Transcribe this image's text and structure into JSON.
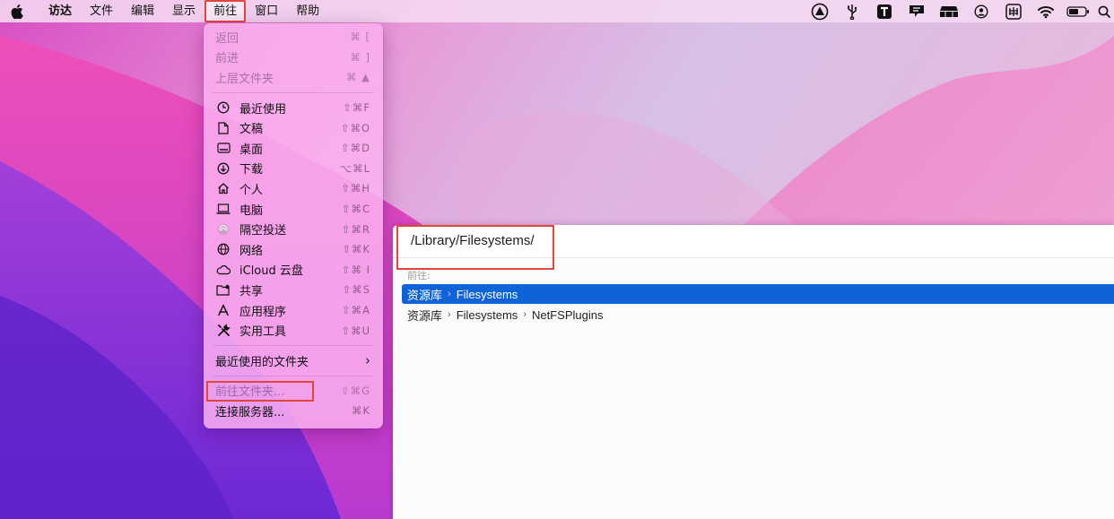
{
  "menubar": {
    "apple_icon": "apple-icon",
    "items": [
      {
        "label": "访达"
      },
      {
        "label": "文件"
      },
      {
        "label": "编辑"
      },
      {
        "label": "显示"
      },
      {
        "label": "前往"
      },
      {
        "label": "窗口"
      },
      {
        "label": "帮助"
      }
    ],
    "status_icons": [
      "triangle-app-icon",
      "usb-icon",
      "text-t-icon",
      "notification-icon",
      "menu-stack-icon",
      "user-circle-icon",
      "input-method-icon",
      "wifi-icon",
      "battery-icon",
      "search-icon"
    ],
    "active_item": "前往"
  },
  "go_menu": {
    "back": {
      "label": "返回",
      "shortcut": "⌘ ["
    },
    "forward": {
      "label": "前进",
      "shortcut": "⌘ ]"
    },
    "enclosing": {
      "label": "上层文件夹",
      "shortcut": "⌘ ▲"
    },
    "places": [
      {
        "label": "最近使用",
        "shortcut": "⇧⌘F",
        "icon": "clock-icon"
      },
      {
        "label": "文稿",
        "shortcut": "⇧⌘O",
        "icon": "document-icon"
      },
      {
        "label": "桌面",
        "shortcut": "⇧⌘D",
        "icon": "desktop-icon"
      },
      {
        "label": "下载",
        "shortcut": "⌥⌘L",
        "icon": "download-icon"
      },
      {
        "label": "个人",
        "shortcut": "⇧⌘H",
        "icon": "home-icon"
      },
      {
        "label": "电脑",
        "shortcut": "⇧⌘C",
        "icon": "laptop-icon"
      },
      {
        "label": "隔空投送",
        "shortcut": "⇧⌘R",
        "icon": "airdrop-icon"
      },
      {
        "label": "网络",
        "shortcut": "⇧⌘K",
        "icon": "globe-icon"
      },
      {
        "label": "iCloud 云盘",
        "shortcut": "⇧⌘ I",
        "icon": "cloud-icon"
      },
      {
        "label": "共享",
        "shortcut": "⇧⌘S",
        "icon": "shared-folder-icon"
      },
      {
        "label": "应用程序",
        "shortcut": "⇧⌘A",
        "icon": "applications-icon"
      },
      {
        "label": "实用工具",
        "shortcut": "⇧⌘U",
        "icon": "utilities-icon"
      }
    ],
    "recent_folders": {
      "label": "最近使用的文件夹"
    },
    "go_to_folder": {
      "label": "前往文件夹...",
      "shortcut": "⇧⌘G"
    },
    "connect_server": {
      "label": "连接服务器...",
      "shortcut": "⌘K"
    }
  },
  "go_panel": {
    "path_value": "/Library/Filesystems/",
    "section_label": "前往:",
    "results": [
      {
        "parts": [
          "资源库",
          "Filesystems"
        ]
      },
      {
        "parts": [
          "资源库",
          "Filesystems",
          "NetFSPlugins"
        ]
      }
    ]
  },
  "colors": {
    "highlight_box": "#e0463c",
    "selection_blue": "#0f63d8"
  }
}
